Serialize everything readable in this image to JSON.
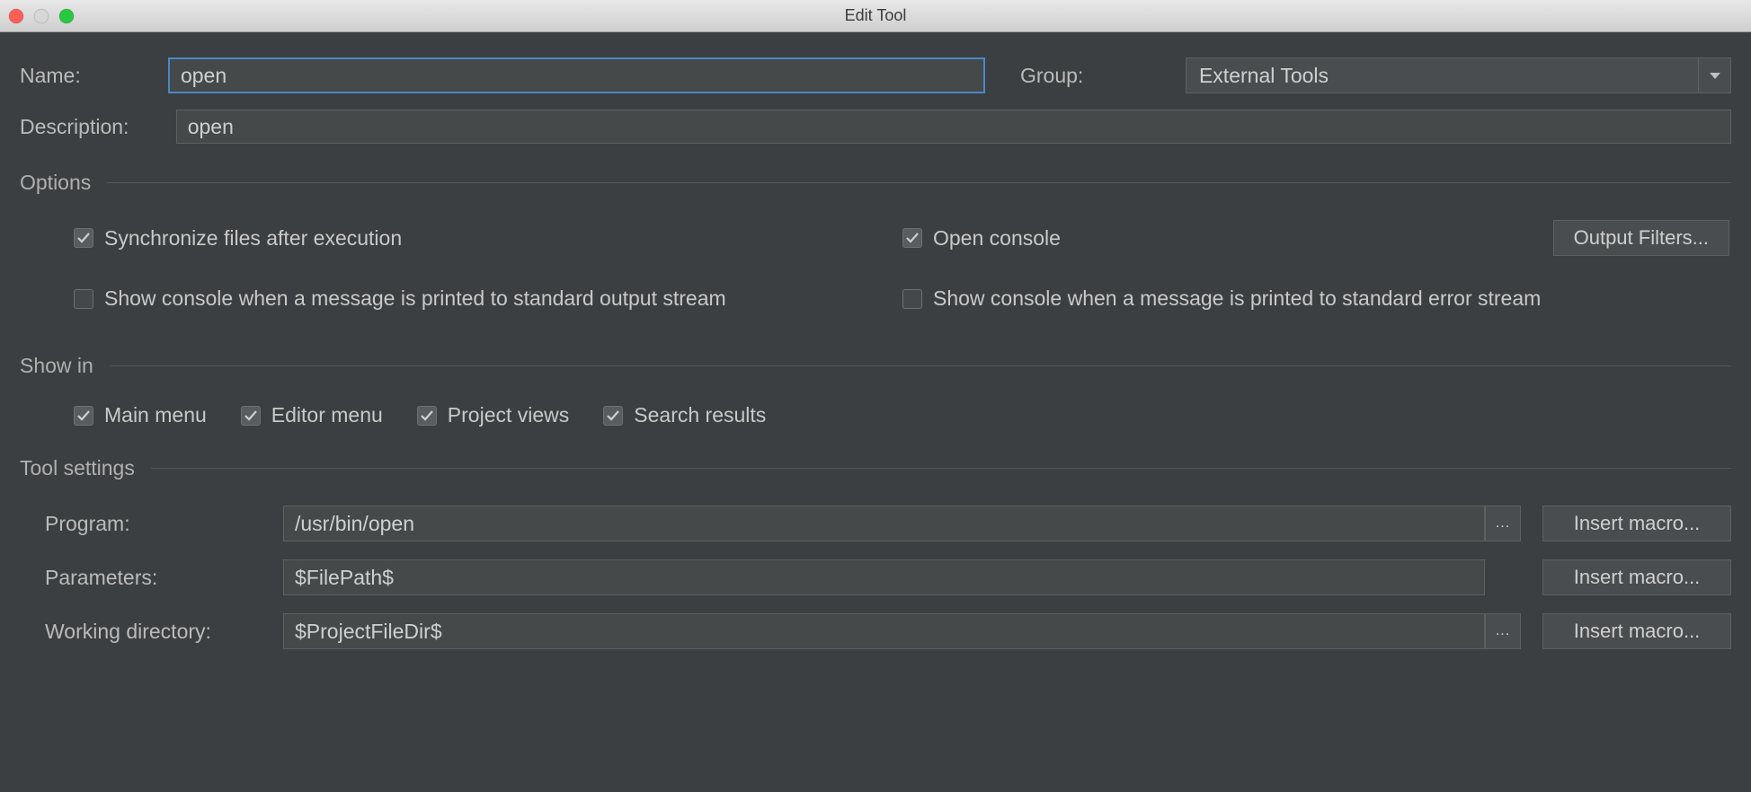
{
  "window": {
    "title": "Edit Tool"
  },
  "fields": {
    "name_label": "Name:",
    "name_value": "open",
    "group_label": "Group:",
    "group_value": "External Tools",
    "description_label": "Description:",
    "description_value": "open"
  },
  "sections": {
    "options": "Options",
    "showin": "Show in",
    "tool_settings": "Tool settings"
  },
  "options": {
    "sync_files": {
      "label": "Synchronize files after execution",
      "checked": true
    },
    "open_console": {
      "label": "Open console",
      "checked": true
    },
    "show_stdout": {
      "label": "Show console when a message is printed to standard output stream",
      "checked": false
    },
    "show_stderr": {
      "label": "Show console when a message is printed to standard error stream",
      "checked": false
    },
    "output_filters_btn": "Output Filters..."
  },
  "showin": {
    "main_menu": {
      "label": "Main menu",
      "checked": true
    },
    "editor_menu": {
      "label": "Editor menu",
      "checked": true
    },
    "project_views": {
      "label": "Project views",
      "checked": true
    },
    "search_results": {
      "label": "Search results",
      "checked": true
    }
  },
  "tool": {
    "program_label": "Program:",
    "program_value": "/usr/bin/open",
    "parameters_label": "Parameters:",
    "parameters_value": "$FilePath$",
    "workdir_label": "Working directory:",
    "workdir_value": "$ProjectFileDir$",
    "browse_btn": "...",
    "insert_macro_btn": "Insert macro..."
  }
}
